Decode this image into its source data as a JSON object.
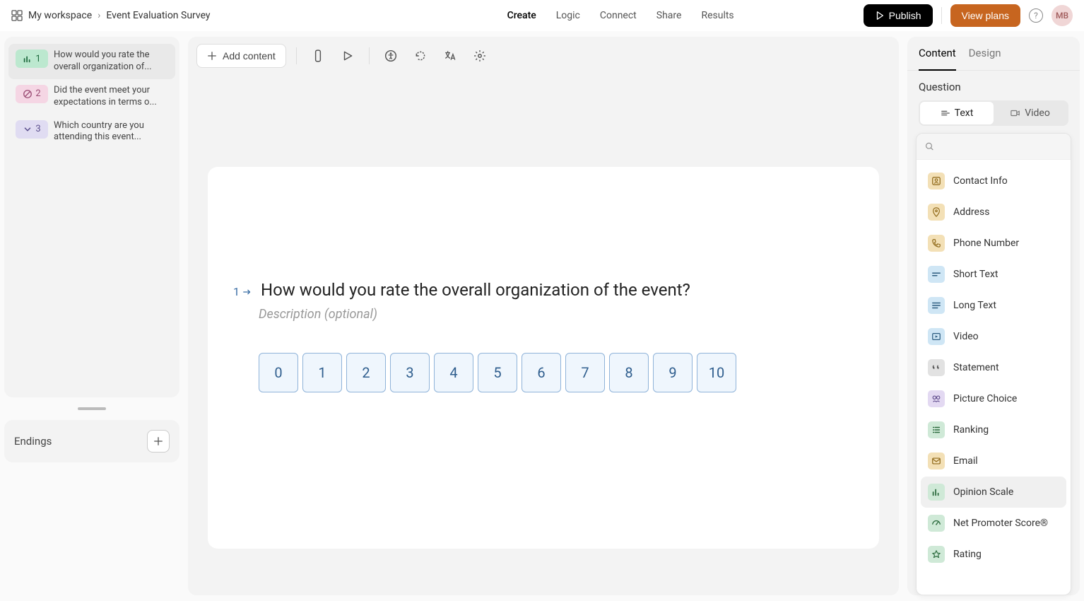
{
  "breadcrumb": {
    "workspace": "My workspace",
    "form": "Event Evaluation Survey"
  },
  "topnav": {
    "create": "Create",
    "logic": "Logic",
    "connect": "Connect",
    "share": "Share",
    "results": "Results",
    "active": "create"
  },
  "header": {
    "publish": "Publish",
    "viewplans": "View plans",
    "avatar": "MB"
  },
  "sidebar": {
    "questions": [
      {
        "num": "1",
        "text": "How would you rate the overall organization of...",
        "color": "green",
        "icon": "bar"
      },
      {
        "num": "2",
        "text": "Did the event meet your expectations in terms o...",
        "color": "pink",
        "icon": "ban"
      },
      {
        "num": "3",
        "text": "Which country are you attending this event...",
        "color": "lav",
        "icon": "chev"
      }
    ],
    "endings": {
      "title": "Endings"
    }
  },
  "toolbar": {
    "addcontent": "Add content"
  },
  "question": {
    "number": "1",
    "title": "How would you rate the overall organization of the event?",
    "desc_placeholder": "Description (optional)",
    "options": [
      "0",
      "1",
      "2",
      "3",
      "4",
      "5",
      "6",
      "7",
      "8",
      "9",
      "10"
    ]
  },
  "rside": {
    "tabs": {
      "content": "Content",
      "design": "Design",
      "active": "content"
    },
    "section_label": "Question",
    "segment": {
      "text": "Text",
      "video": "Video",
      "active": "text"
    },
    "search_placeholder": "",
    "types": [
      {
        "label": "Contact Info",
        "icon": "user",
        "cls": "i-yellow"
      },
      {
        "label": "Address",
        "icon": "pin",
        "cls": "i-yellow"
      },
      {
        "label": "Phone Number",
        "icon": "phone",
        "cls": "i-yellow"
      },
      {
        "label": "Short Text",
        "icon": "short",
        "cls": "i-blue"
      },
      {
        "label": "Long Text",
        "icon": "long",
        "cls": "i-blue"
      },
      {
        "label": "Video",
        "icon": "video",
        "cls": "i-blue"
      },
      {
        "label": "Statement",
        "icon": "quote",
        "cls": "i-gray"
      },
      {
        "label": "Picture Choice",
        "icon": "pic",
        "cls": "i-purple"
      },
      {
        "label": "Ranking",
        "icon": "rank",
        "cls": "i-green"
      },
      {
        "label": "Email",
        "icon": "mail",
        "cls": "i-yellow"
      },
      {
        "label": "Opinion Scale",
        "icon": "bar",
        "cls": "i-green",
        "selected": true
      },
      {
        "label": "Net Promoter Score®",
        "icon": "gauge",
        "cls": "i-green"
      },
      {
        "label": "Rating",
        "icon": "star",
        "cls": "i-green"
      }
    ]
  }
}
